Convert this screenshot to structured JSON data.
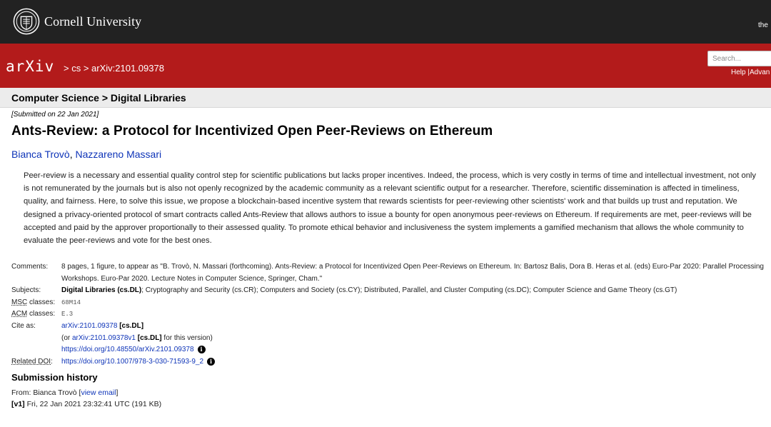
{
  "cornell": {
    "name": "Cornell University",
    "right_text": "the"
  },
  "header": {
    "logo_text": "arXiv",
    "breadcrumb": [
      "> cs >",
      "arXiv:2101.09378"
    ],
    "search_placeholder": "Search...",
    "help_links": [
      "Help",
      "|",
      "Advan"
    ]
  },
  "subheader": "Computer Science > Digital Libraries",
  "paper": {
    "submitted": "[Submitted on 22 Jan 2021]",
    "title": "Ants-Review: a Protocol for Incentivized Open Peer-Reviews on Ethereum",
    "authors": [
      "Bianca Trovò",
      "Nazzareno Massari"
    ],
    "abstract": "Peer-review is a necessary and essential quality control step for scientific publications but lacks proper incentives. Indeed, the process, which is very costly in terms of time and intellectual investment, not only is not remunerated by the journals but is also not openly recognized by the academic community as a relevant scientific output for a researcher. Therefore, scientific dissemination is affected in timeliness, quality, and fairness. Here, to solve this issue, we propose a blockchain-based incentive system that rewards scientists for peer-reviewing other scientists' work and that builds up trust and reputation. We designed a privacy-oriented protocol of smart contracts called Ants-Review that allows authors to issue a bounty for open anonymous peer-reviews on Ethereum. If requirements are met, peer-reviews will be accepted and paid by the approver proportionally to their assessed quality. To promote ethical behavior and inclusiveness the system implements a gamified mechanism that allows the whole community to evaluate the peer-reviews and vote for the best ones."
  },
  "meta": {
    "comments_label": "Comments:",
    "comments": "8 pages, 1 figure, to appear as \"B. Trovò, N. Massari (forthcoming). Ants-Review: a Protocol for Incentivized Open Peer-Reviews on Ethereum. In: Bartosz Balis, Dora B. Heras et al. (eds) Euro-Par 2020: Parallel Processing Workshops. Euro-Par 2020. Lecture Notes in Computer Science, Springer, Cham.\"",
    "subjects_label": "Subjects:",
    "subjects_primary": "Digital Libraries (cs.DL)",
    "subjects_rest": "; Cryptography and Security (cs.CR); Computers and Society (cs.CY); Distributed, Parallel, and Cluster Computing (cs.DC); Computer Science and Game Theory (cs.GT)",
    "msc_abbr": "MSC",
    "msc_suffix": " classes:",
    "msc_value": "68M14",
    "acm_abbr": "ACM",
    "acm_suffix": " classes:",
    "acm_value": "E.3",
    "cite_label": "Cite as:",
    "cite_id": "arXiv:2101.09378",
    "cite_cat": "[cs.DL]",
    "cite_v_prefix": "(or ",
    "cite_v_id": "arXiv:2101.09378v1",
    "cite_v_cat": "[cs.DL]",
    "cite_v_suffix": " for this version)",
    "cite_doi": "https://doi.org/10.48550/arXiv.2101.09378",
    "related_abbr": "Related DOI",
    "related_suffix": ":",
    "related_doi": "https://doi.org/10.1007/978-3-030-71593-9_2",
    "info_glyph": "i"
  },
  "history": {
    "title": "Submission history",
    "from_prefix": "From: Bianca Trovò [",
    "view_email": "view email",
    "from_suffix": "]",
    "v1_label": "[v1]",
    "v1_text": " Fri, 22 Jan 2021 23:32:41 UTC (191 KB)"
  },
  "colors": {
    "header_red": "#b31b1b",
    "cornell_dark": "#222222",
    "link_blue": "#0e34b8"
  }
}
